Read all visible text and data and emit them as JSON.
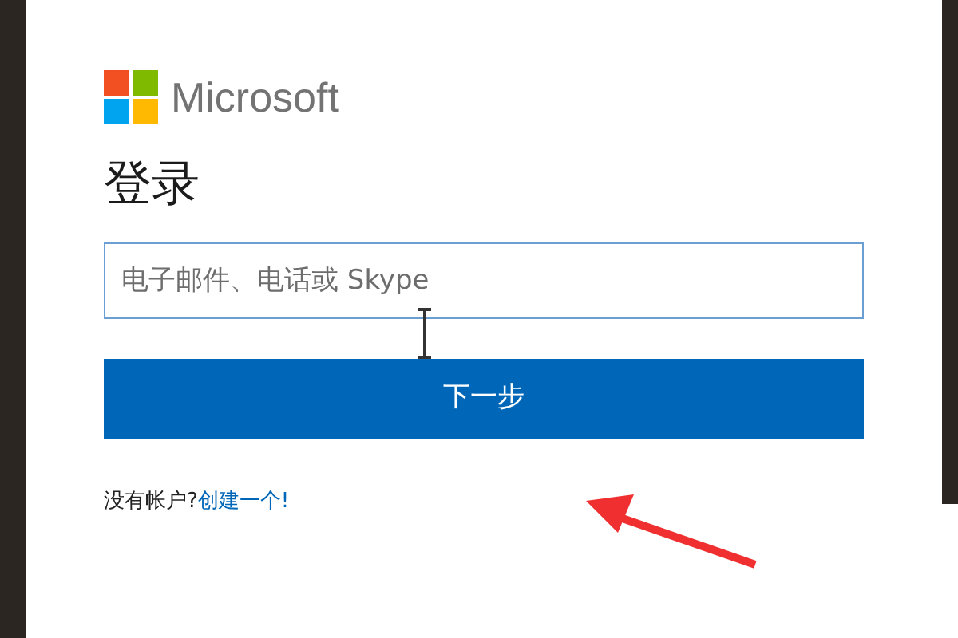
{
  "logo": {
    "text": "Microsoft"
  },
  "heading": "登录",
  "email_field": {
    "placeholder": "电子邮件、电话或 Skype"
  },
  "next_button": {
    "label": "下一步"
  },
  "signup": {
    "text": "没有帐户?",
    "link": "创建一个!"
  }
}
